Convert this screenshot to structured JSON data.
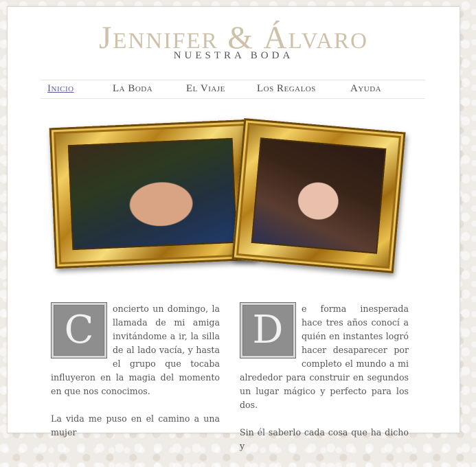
{
  "header": {
    "title": "Jennifer & Álvaro",
    "subtitle": "NUESTRA BODA"
  },
  "nav": {
    "items": [
      {
        "label": "Inicio",
        "active": true
      },
      {
        "label": "La Boda",
        "active": false
      },
      {
        "label": "El Viaje",
        "active": false
      },
      {
        "label": "Los Regalos",
        "active": false
      },
      {
        "label": "Ayuda",
        "active": false
      }
    ]
  },
  "photos": [
    {
      "subject": "Álvaro portrait in gold frame"
    },
    {
      "subject": "Jennifer portrait in gold frame"
    }
  ],
  "columns": [
    {
      "dropcap": "C",
      "paragraph1": "oncierto un domingo, la llamada de mi amiga invitándome a ir, la silla de al lado vacía, y hasta el grupo que tocaba influyeron en la magia del momento en que nos conocimos.",
      "paragraph2": "La vida me puso en el camino a una mujer"
    },
    {
      "dropcap": "D",
      "paragraph1": "e forma inesperada hace tres años conocí a quién en instantes logró hacer desaparecer por completo el mundo a mi alrededor para construir en segundos un lugar mágico y perfecto para los dos.",
      "paragraph2": "Sin él saberlo cada cosa que ha dicho y"
    }
  ],
  "colors": {
    "title": "#cec1a9",
    "link_active": "#5a5a9a",
    "text": "#555555",
    "frame_gold": "#d4a93a"
  }
}
